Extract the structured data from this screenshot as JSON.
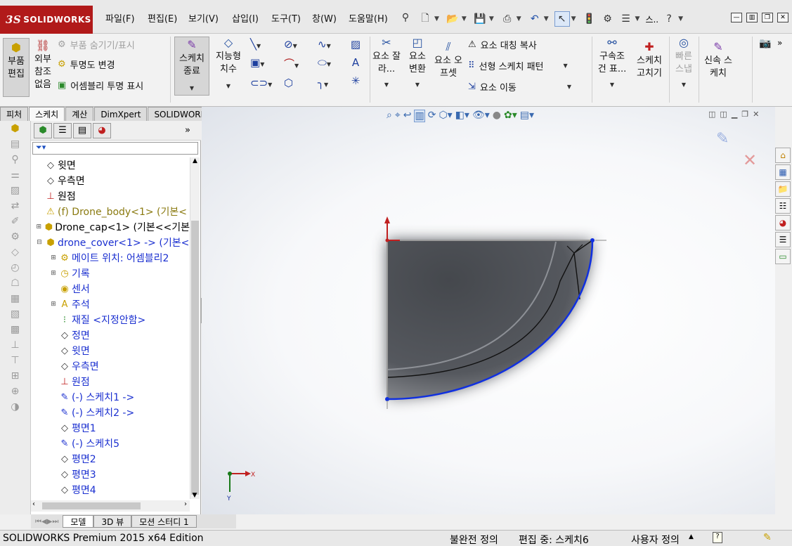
{
  "app": {
    "logo_ds": "3S",
    "logo_name": "SOLIDWORKS"
  },
  "menu": [
    "파일(F)",
    "편집(E)",
    "보기(V)",
    "삽입(I)",
    "도구(T)",
    "창(W)",
    "도움말(H)"
  ],
  "quick_access": {
    "search_short": "스..",
    "help": "?"
  },
  "ribbon": {
    "edit_part": "부품 편집",
    "external_refs": "외부 참조 없음",
    "hide_show_parts": "부품 숨기기/표시",
    "change_transparency": "투명도 변경",
    "assembly_transparency": "어셈블리 투명 표시",
    "exit_sketch": "스케치 종료",
    "smart_dimension": "지능형 치수",
    "trim_entities": "요소 잘라...",
    "convert_entities": "요소 변환",
    "offset_entities": "요소 오프셋",
    "mirror_entities": "요소 대칭 복사",
    "linear_pattern": "선형 스케치 패턴",
    "move_entities": "요소 이동",
    "display_relations": "구속조건 표...",
    "repair_sketch": "스케치 고치기",
    "quick_snaps": "빠른 스냅",
    "rapid_sketch": "신속 스케치"
  },
  "command_tabs": [
    "피처",
    "스케치",
    "계산",
    "DimXpert",
    "SOLIDWORKS 애드인"
  ],
  "feature_manager": {
    "filter_icon": "filter-icon",
    "tree": [
      {
        "label": "윗면",
        "color": "black",
        "icon": "plane-icon",
        "indent": 0
      },
      {
        "label": "우측면",
        "color": "black",
        "icon": "plane-icon",
        "indent": 0
      },
      {
        "label": "원점",
        "color": "black",
        "icon": "origin-icon",
        "indent": 0
      },
      {
        "label": "(f) Drone_body<1> (기본<",
        "color": "olive",
        "icon": "part-warning-icon",
        "indent": 0
      },
      {
        "label": "Drone_cap<1> (기본<<기본",
        "color": "black",
        "icon": "part-icon",
        "indent": 0,
        "expand": "+"
      },
      {
        "label": "drone_cover<1> -> (기본<",
        "color": "blue",
        "icon": "part-icon",
        "indent": 0,
        "expand": "-"
      },
      {
        "label": "메이트 위치: 어셈블리2",
        "color": "blue",
        "icon": "mate-icon",
        "indent": 1,
        "expand": "+"
      },
      {
        "label": "기록",
        "color": "blue",
        "icon": "history-icon",
        "indent": 1,
        "expand": "+"
      },
      {
        "label": "센서",
        "color": "blue",
        "icon": "sensor-icon",
        "indent": 1
      },
      {
        "label": "주석",
        "color": "blue",
        "icon": "annotation-icon",
        "indent": 1,
        "expand": "+"
      },
      {
        "label": "재질 <지정안함>",
        "color": "blue",
        "icon": "material-icon",
        "indent": 1
      },
      {
        "label": "정면",
        "color": "blue",
        "icon": "plane-icon",
        "indent": 1
      },
      {
        "label": "윗면",
        "color": "blue",
        "icon": "plane-icon",
        "indent": 1
      },
      {
        "label": "우측면",
        "color": "blue",
        "icon": "plane-icon",
        "indent": 1
      },
      {
        "label": "원점",
        "color": "blue",
        "icon": "origin-icon",
        "indent": 1
      },
      {
        "label": "(-) 스케치1 ->",
        "color": "blue",
        "icon": "sketch-icon",
        "indent": 1
      },
      {
        "label": "(-) 스케치2 ->",
        "color": "blue",
        "icon": "sketch-icon",
        "indent": 1
      },
      {
        "label": "평면1",
        "color": "blue",
        "icon": "plane-icon",
        "indent": 1
      },
      {
        "label": "(-) 스케치5",
        "color": "blue",
        "icon": "sketch-icon",
        "indent": 1
      },
      {
        "label": "평면2",
        "color": "blue",
        "icon": "plane-icon",
        "indent": 1
      },
      {
        "label": "평면3",
        "color": "blue",
        "icon": "plane-icon",
        "indent": 1
      },
      {
        "label": "평면4",
        "color": "blue",
        "icon": "plane-icon",
        "indent": 1
      }
    ]
  },
  "bottom_tabs": [
    "모델",
    "3D 뷰",
    "모션 스터디 1"
  ],
  "status": {
    "product": "SOLIDWORKS Premium 2015 x64 Edition",
    "definition": "불완전 정의",
    "editing": "편집 중: 스케치6",
    "units": "사용자 정의"
  },
  "triad": {
    "x": "X",
    "y": "Y"
  }
}
